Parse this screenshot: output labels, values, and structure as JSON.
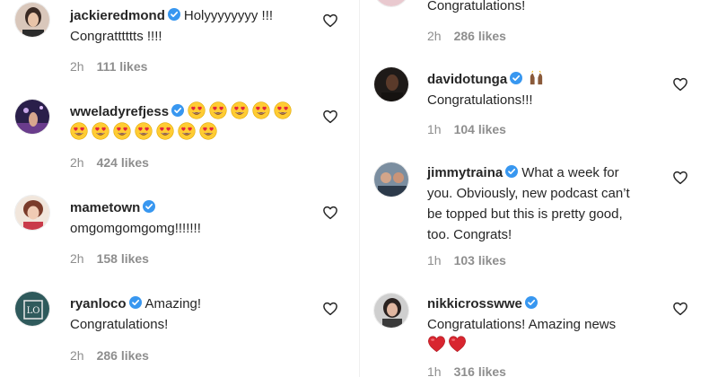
{
  "left_column": [
    {
      "username": "jackieredmond",
      "verified": true,
      "lines": [
        "Holyyyyyyyy !!!",
        "Congratttttts !!!!"
      ],
      "time": "2h",
      "likes": "111 likes"
    },
    {
      "username": "wweladyrefjess",
      "verified": true,
      "emoji": "heart-eyes-emoji",
      "emoji_count_line1": 5,
      "emoji_count_line2": 7,
      "time": "2h",
      "likes": "424 likes"
    },
    {
      "username": "mametown",
      "verified": true,
      "lines": [
        "omgomgomgomg!!!!!!!"
      ],
      "time": "2h",
      "likes": "158 likes"
    },
    {
      "username": "ryanloco",
      "verified": true,
      "lines": [
        "Amazing!",
        "Congratulations!"
      ],
      "time": "2h",
      "likes": "286 likes"
    }
  ],
  "right_column": [
    {
      "partial": true,
      "lines": [
        "Congratulations!"
      ],
      "time": "2h",
      "likes": "286 likes"
    },
    {
      "username": "davidotunga",
      "verified": true,
      "extra_emoji": "raising-hands-emoji",
      "lines": [
        "Congratulations!!!"
      ],
      "time": "1h",
      "likes": "104 likes"
    },
    {
      "username": "jimmytraina",
      "verified": true,
      "lines": [
        "What a week for",
        "you. Obviously, new podcast can’t",
        "be topped but this is pretty good,",
        "too. Congrats!"
      ],
      "time": "1h",
      "likes": "103 likes"
    },
    {
      "username": "nikkicrosswwe",
      "verified": true,
      "lines": [
        "Congratulations! Amazing news"
      ],
      "emoji": "red-heart-emoji",
      "emoji_count": 2,
      "time": "1h",
      "likes": "316 likes"
    }
  ],
  "colors": {
    "text": "#262626",
    "secondary": "#8e8e8e",
    "verified": "#3897f0",
    "heart_red": "#ed4956"
  }
}
